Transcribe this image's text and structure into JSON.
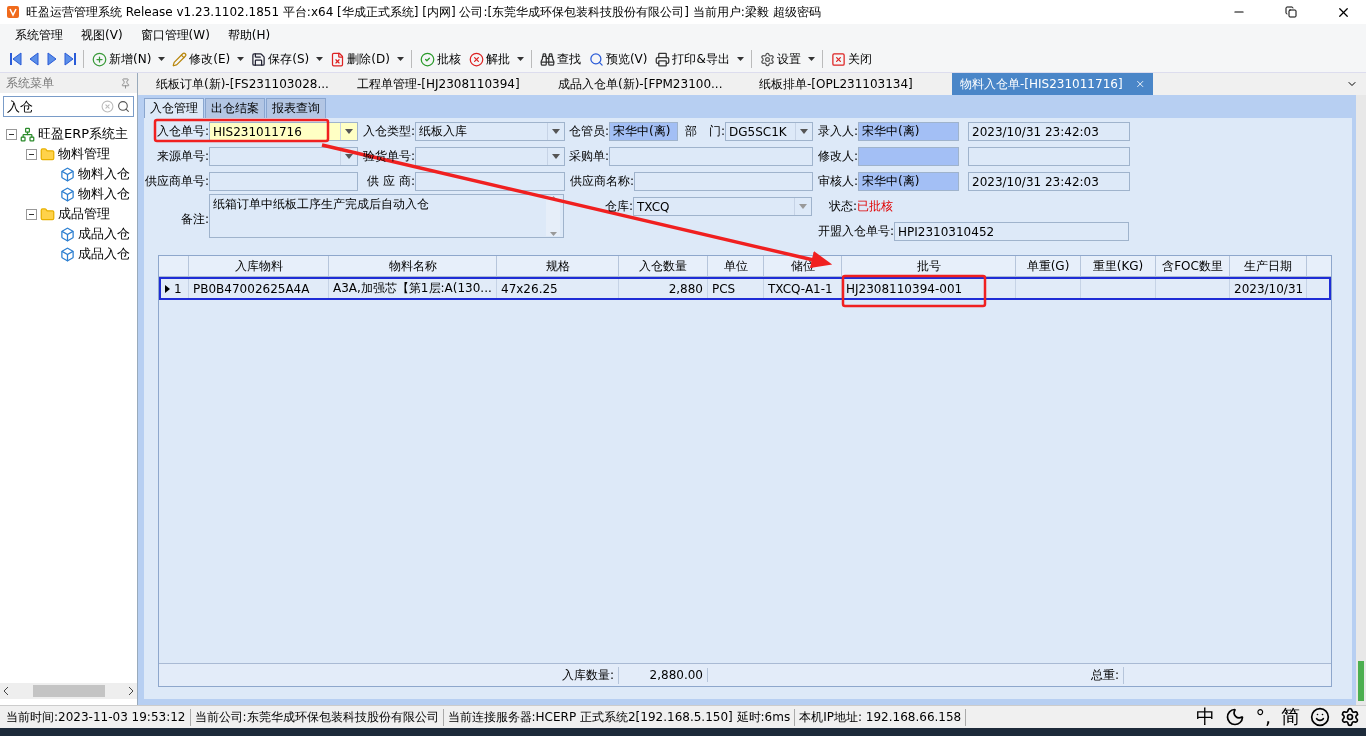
{
  "window": {
    "title": "旺盈运营管理系统 Release v1.23.1102.1851 平台:x64  [华成正式系统] [内网] 公司:[东莞华成环保包装科技股份有限公司] 当前用户:梁毅  超级密码"
  },
  "menu": [
    "系统管理",
    "视图(V)",
    "窗口管理(W)",
    "帮助(H)"
  ],
  "toolbar": [
    {
      "kind": "nav"
    },
    {
      "kind": "nav"
    },
    {
      "kind": "nav"
    },
    {
      "kind": "nav"
    },
    {
      "kind": "button",
      "label": "新增(N)",
      "dropdown": true
    },
    {
      "kind": "button",
      "label": "修改(E)",
      "dropdown": true
    },
    {
      "kind": "button",
      "label": "保存(S)",
      "dropdown": true
    },
    {
      "kind": "button",
      "label": "删除(D)",
      "dropdown": true
    },
    {
      "kind": "button",
      "label": "批核",
      "dropdown": false
    },
    {
      "kind": "button",
      "label": "解批",
      "dropdown": true
    },
    {
      "kind": "button",
      "label": "查找",
      "dropdown": false
    },
    {
      "kind": "button",
      "label": "预览(V)",
      "dropdown": false
    },
    {
      "kind": "button",
      "label": "打印&导出",
      "dropdown": true
    },
    {
      "kind": "button",
      "label": "设置",
      "dropdown": true
    },
    {
      "kind": "button",
      "label": "关闭",
      "dropdown": false
    }
  ],
  "sidebar": {
    "title": "系统菜单",
    "search": "入仓",
    "tree": [
      {
        "label": "旺盈ERP系统主",
        "expanded": true,
        "children": [
          {
            "label": "物料管理",
            "expanded": true,
            "children": [
              {
                "label": "物料入仓"
              },
              {
                "label": "物料入仓"
              }
            ]
          },
          {
            "label": "成品管理",
            "expanded": true,
            "children": [
              {
                "label": "成品入仓"
              },
              {
                "label": "成品入仓"
              }
            ]
          }
        ]
      }
    ]
  },
  "doc_tabs": [
    {
      "label": "纸板订单(新)-[FS231103028...",
      "selected": false
    },
    {
      "label": "工程单管理-[HJ2308110394]",
      "selected": false
    },
    {
      "label": "成品入仓单(新)-[FPM23100...",
      "selected": false
    },
    {
      "label": "纸板排单-[OPL231103134]",
      "selected": false
    },
    {
      "label": "物料入仓单-[HIS231011716]",
      "selected": true
    }
  ],
  "sub_tabs": [
    {
      "label": "入仓管理",
      "selected": true
    },
    {
      "label": "出仓结案",
      "selected": false
    },
    {
      "label": "报表查询",
      "selected": false
    }
  ],
  "form": {
    "fields": [
      {
        "label": "入仓单号:",
        "value": "HIS231011716",
        "kind": "combo",
        "highlighted": false,
        "focused": true
      },
      {
        "label": "入仓类型:",
        "value": "纸板入库",
        "kind": "combo",
        "highlighted": false,
        "focused": false
      },
      {
        "label": "仓管员:",
        "value": "宋华中(离)",
        "kind": "text",
        "highlighted": true,
        "focused": false
      },
      {
        "label": "部　门:",
        "value": "DG5SC1K",
        "kind": "combo",
        "highlighted": false,
        "focused": false
      },
      {
        "label": "录入人:",
        "value": "宋华中(离)",
        "kind": "text",
        "highlighted": true,
        "focused": false
      },
      {
        "value": "2023/10/31 23:42:03",
        "kind": "text",
        "highlighted": false,
        "focused": false
      },
      {
        "label": "来源单号:",
        "kind": "combo",
        "highlighted": false,
        "focused": false
      },
      {
        "label": "验货单号:",
        "kind": "combo",
        "highlighted": false,
        "focused": false
      },
      {
        "label": "采购单:",
        "kind": "text",
        "highlighted": false,
        "focused": false
      },
      {
        "label": "修改人:",
        "kind": "text",
        "highlighted": true,
        "focused": false
      },
      {
        "kind": "text",
        "highlighted": false,
        "focused": false
      },
      {
        "label": "供应商单号:",
        "kind": "text",
        "highlighted": false,
        "focused": false
      },
      {
        "label": "供 应 商:",
        "kind": "text",
        "highlighted": false,
        "focused": false
      },
      {
        "label": "供应商名称:",
        "kind": "text",
        "highlighted": false,
        "focused": false
      },
      {
        "label": "审核人:",
        "value": "宋华中(离)",
        "kind": "text",
        "highlighted": true,
        "focused": false
      },
      {
        "value": "2023/10/31 23:42:03",
        "kind": "text",
        "highlighted": false,
        "focused": false
      }
    ],
    "memo": {
      "label": "备注:",
      "value": "纸箱订单中纸板工序生产完成后自动入仓"
    },
    "warehouse": {
      "label": "仓库:",
      "value": "TXCQ"
    },
    "status": {
      "label": "状态:",
      "value": "已批核"
    },
    "union_no": {
      "label": "开盟入仓单号:",
      "value": "HPI2310310452"
    }
  },
  "table": {
    "columns": [
      "入库物料",
      "物料名称",
      "规格",
      "入仓数量",
      "单位",
      "储位",
      "批号",
      "单重(G)",
      "重里(KG)",
      "含FOC数里",
      "生产日期"
    ],
    "rows": [
      {
        "index": "1",
        "selected": true,
        "cells": [
          "PB0B47002625A4A",
          "A3A,加强芯【第1层:A(130...",
          "47x26.25",
          "2,880",
          "PCS",
          "TXCQ-A1-1",
          "HJ2308110394-001",
          "",
          "",
          "",
          "2023/10/31"
        ]
      }
    ],
    "footer": {
      "qty_label": "入库数量:",
      "qty": "2,880.00",
      "weight_label": "总重:"
    }
  },
  "status_bar": [
    "当前时间:2023-11-03 19:53:12",
    "当前公司:东莞华成环保包装科技股份有限公司",
    "当前连接服务器:HCERP 正式系统2[192.168.5.150] 延时:6ms",
    "本机IP地址: 192.168.66.158"
  ],
  "ime": [
    "中",
    "°,",
    "简"
  ]
}
